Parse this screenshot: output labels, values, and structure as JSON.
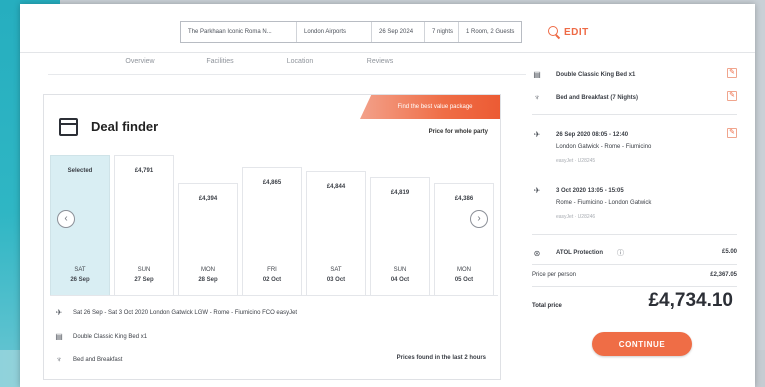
{
  "search": {
    "hotel": "The Parkhaan Iconic Roma N...",
    "departure": "London Airports",
    "date": "26 Sep 2024",
    "nights": "7 nights",
    "rooms": "1 Room, 2 Guests",
    "edit_label": "EDIT"
  },
  "tabs": [
    "Overview",
    "Facilities",
    "Location",
    "Reviews"
  ],
  "deal_finder": {
    "title": "Deal finder",
    "promo": "Find the best value package",
    "price_note": "Price for whole party",
    "days": [
      {
        "price": "Selected",
        "dow": "SAT",
        "date": "26 Sep",
        "selected": true
      },
      {
        "price": "£4,791",
        "dow": "SUN",
        "date": "27 Sep",
        "selected": false
      },
      {
        "price": "£4,394",
        "dow": "MON",
        "date": "28 Sep",
        "selected": false
      },
      {
        "price": "£4,865",
        "dow": "FRI",
        "date": "02 Oct",
        "selected": false
      },
      {
        "price": "£4,844",
        "dow": "SAT",
        "date": "03 Oct",
        "selected": false
      },
      {
        "price": "£4,819",
        "dow": "SUN",
        "date": "04 Oct",
        "selected": false
      },
      {
        "price": "£4,386",
        "dow": "MON",
        "date": "05 Oct",
        "selected": false
      }
    ],
    "flight": "Sat 26 Sep - Sat 3 Oct 2020 London Gatwick LGW - Rome - Fiumicino FCO easyJet",
    "room": "Double Classic King Bed x1",
    "board": "Bed and Breakfast",
    "found_note": "Prices found in the last 2 hours"
  },
  "summary": {
    "room": "Double Classic King Bed x1",
    "board": "Bed and Breakfast (7 Nights)",
    "outbound": {
      "date_time": "26 Sep 2020   08:05 - 12:40",
      "route": "London Gatwick - Rome - Fiumicino",
      "flight_no": "easyJet · U28245"
    },
    "inbound": {
      "date_time": "3 Oct 2020   13:05 - 15:05",
      "route": "Rome - Fiumicino - London Gatwick",
      "flight_no": "easyJet · U28246"
    },
    "atol_label": "ATOL Protection",
    "atol_value": "£5.00",
    "per_person_label": "Price per person",
    "per_person_value": "£2,367.05",
    "total_label": "Total price",
    "total_value": "£4,734.10",
    "continue_label": "CONTINUE"
  },
  "colors": {
    "accent": "#ef6d46",
    "selected_day": "#d9eef3",
    "teal_background": "#2fb6c4"
  }
}
